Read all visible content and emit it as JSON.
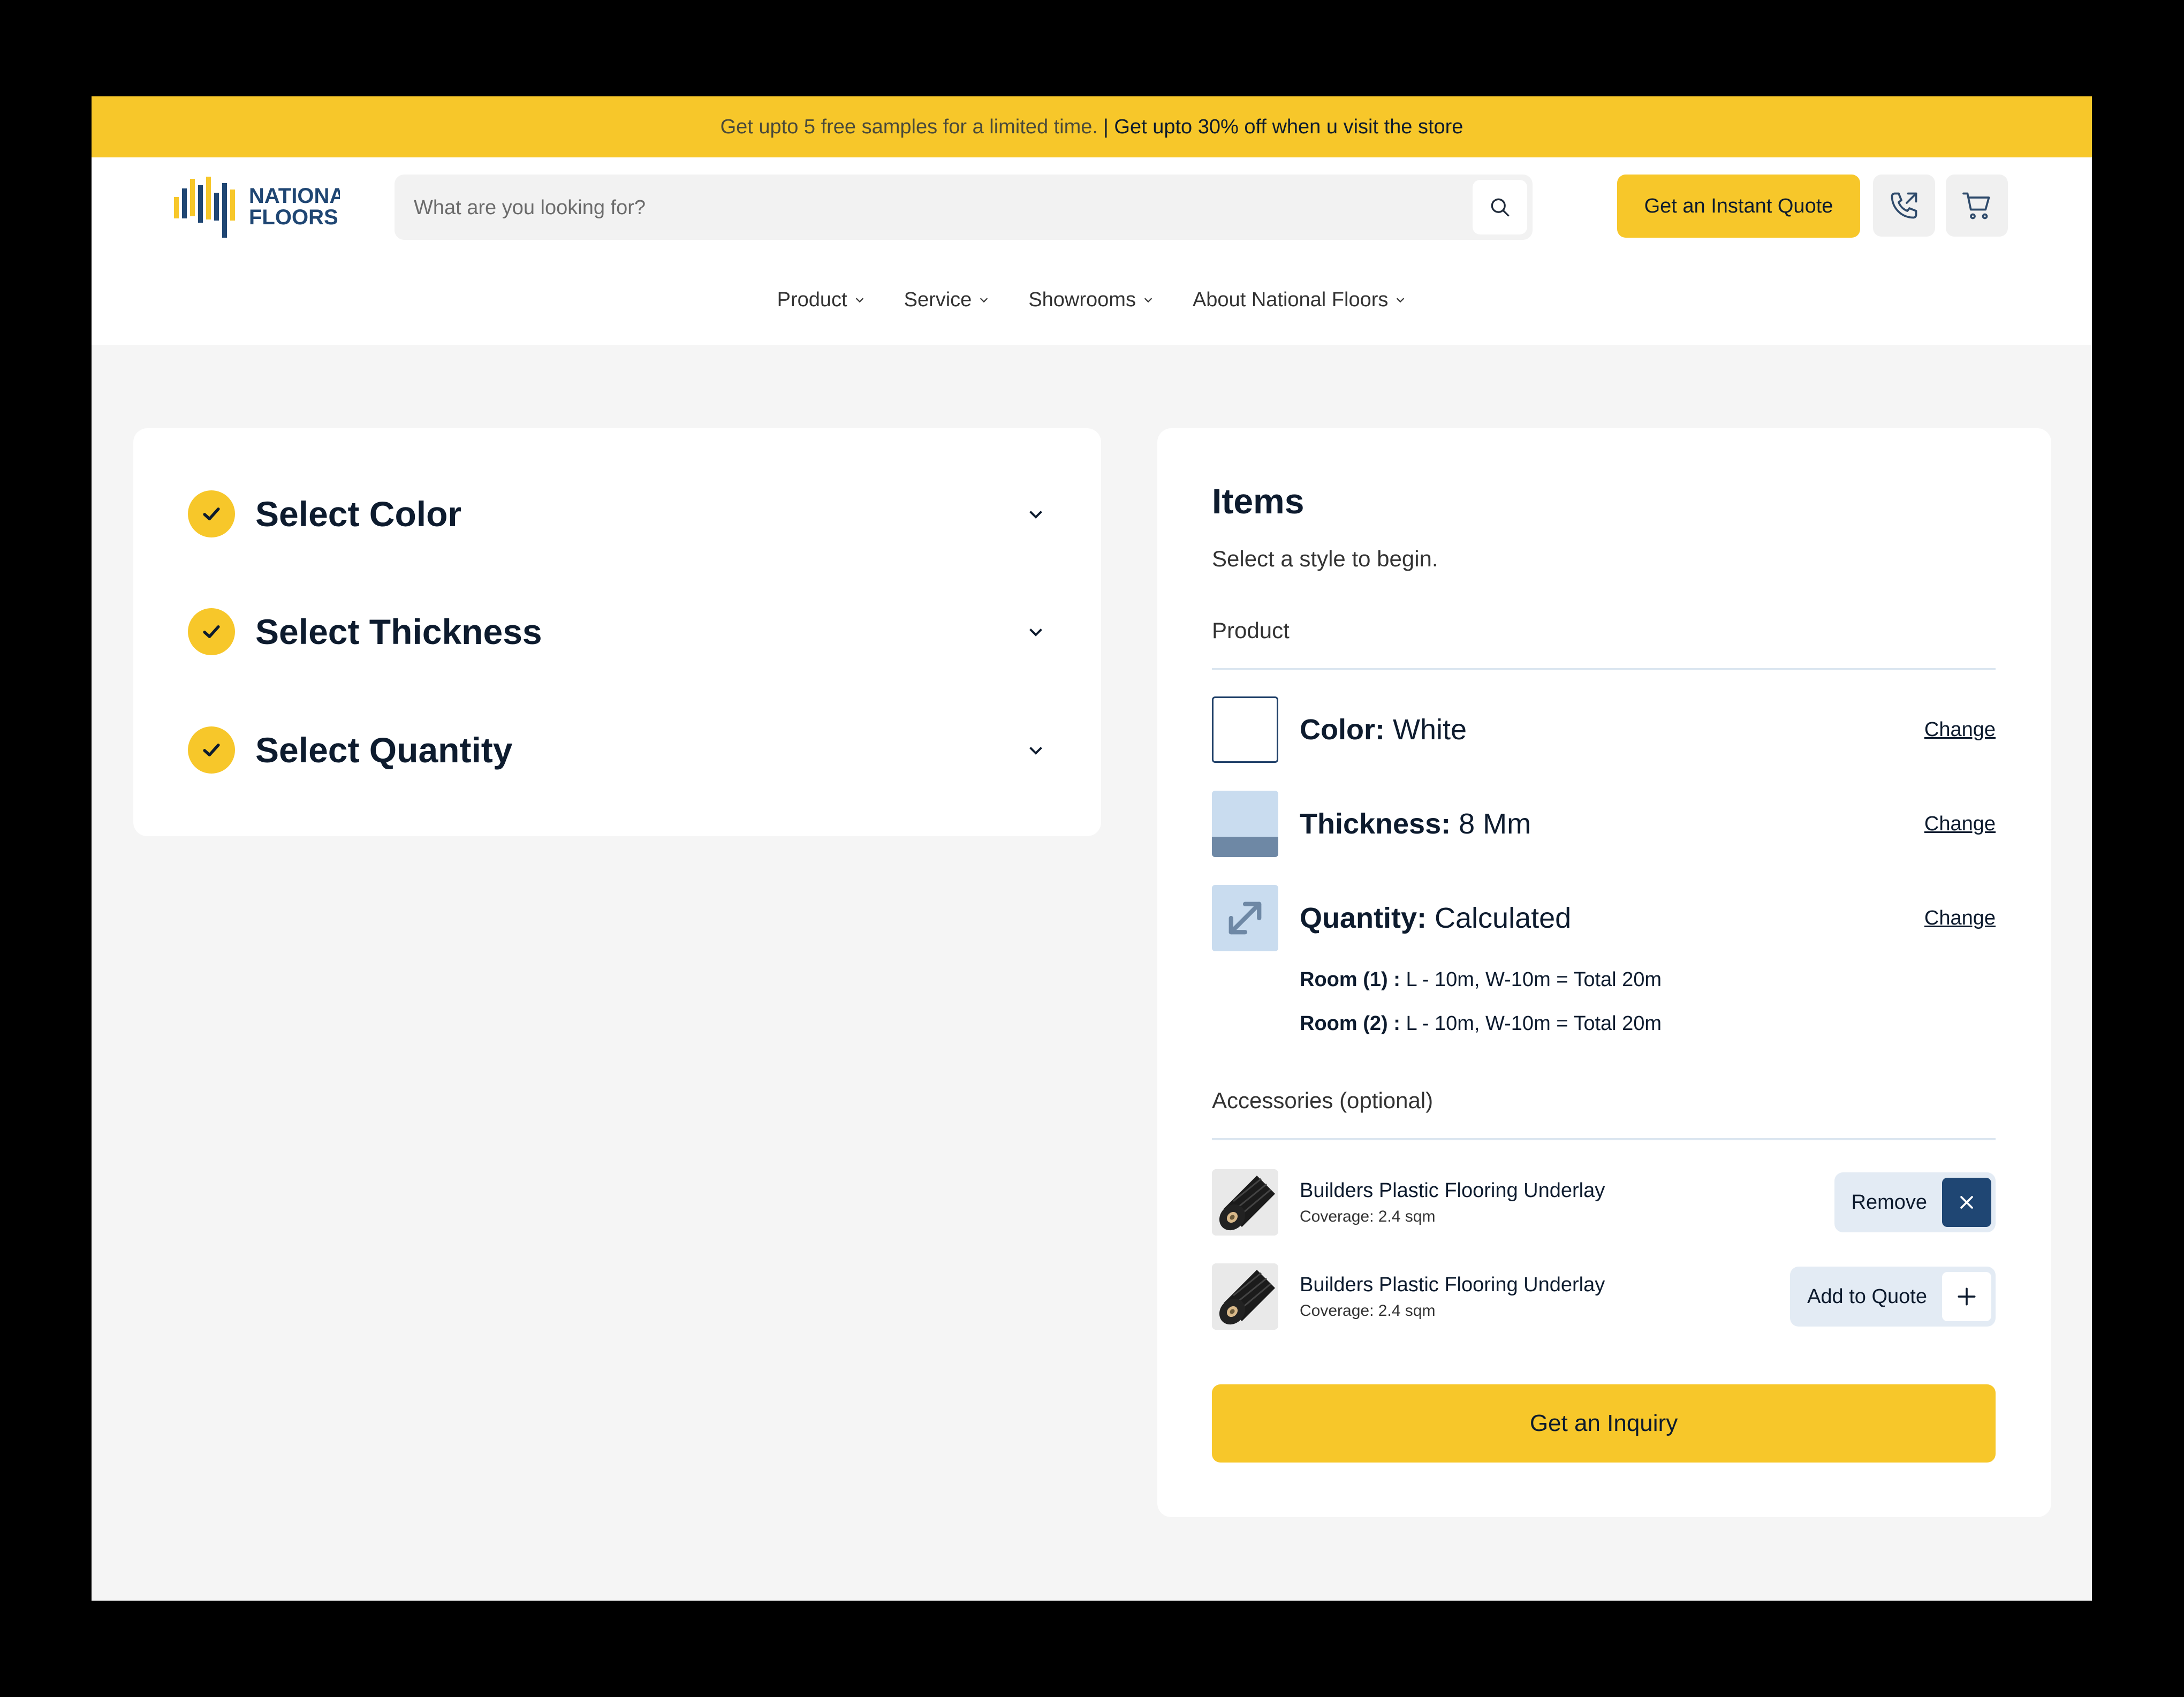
{
  "promo": {
    "text": "Get upto 5 free samples for a limited time.",
    "highlight": "| Get upto 30% off when u visit the store"
  },
  "header": {
    "logo_line1": "NATIONAL",
    "logo_line2": "FLOORS",
    "search_placeholder": "What are you looking for?",
    "quote_button": "Get an Instant Quote"
  },
  "nav": {
    "items": [
      {
        "label": "Product"
      },
      {
        "label": "Service"
      },
      {
        "label": "Showrooms"
      },
      {
        "label": "About National Floors"
      }
    ]
  },
  "steps": [
    {
      "label": "Select Color"
    },
    {
      "label": "Select Thickness"
    },
    {
      "label": "Select Quantity"
    }
  ],
  "summary": {
    "title": "Items",
    "subtitle": "Select a style to begin.",
    "product_label": "Product",
    "color": {
      "key": "Color:",
      "value": "White",
      "change": "Change"
    },
    "thickness": {
      "key": "Thickness:",
      "value": "8 Mm",
      "change": "Change"
    },
    "quantity": {
      "key": "Quantity:",
      "value": "Calculated",
      "change": "Change"
    },
    "rooms": [
      {
        "name": "Room (1) :",
        "detail": "L - 10m, W-10m = Total 20m"
      },
      {
        "name": "Room (2) :",
        "detail": "L - 10m, W-10m = Total 20m"
      }
    ],
    "accessories_label": "Accessories (optional)",
    "accessories": [
      {
        "name": "Builders Plastic Flooring Underlay",
        "coverage": "Coverage: 2.4 sqm",
        "action": "Remove"
      },
      {
        "name": "Builders Plastic Flooring Underlay",
        "coverage": "Coverage: 2.4 sqm",
        "action": "Add to Quote"
      }
    ],
    "inquiry_button": "Get an Inquiry"
  },
  "colors": {
    "accent": "#f7c72a",
    "navy": "#1f4673",
    "light_blue": "#c9dcef"
  }
}
